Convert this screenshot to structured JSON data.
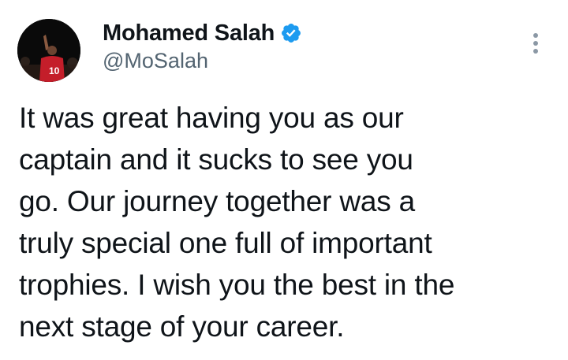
{
  "author": {
    "display_name": "Mohamed Salah",
    "handle": "@MoSalah",
    "verified": true,
    "verified_color": "#1d9bf0",
    "avatar_icon": "profile-photo",
    "avatar_jersey_number": "10"
  },
  "tweet": {
    "text": "It was great having you as our\ncaptain and it sucks to see you\ngo. Our journey together was a\ntruly special one full of important\ntrophies. I wish you the best in the\nnext stage of your career."
  },
  "actions": {
    "more_icon": "more-vertical-icon"
  },
  "colors": {
    "text": "#0f1419",
    "secondary_text": "#536471",
    "more_icon": "#8b98a5"
  }
}
